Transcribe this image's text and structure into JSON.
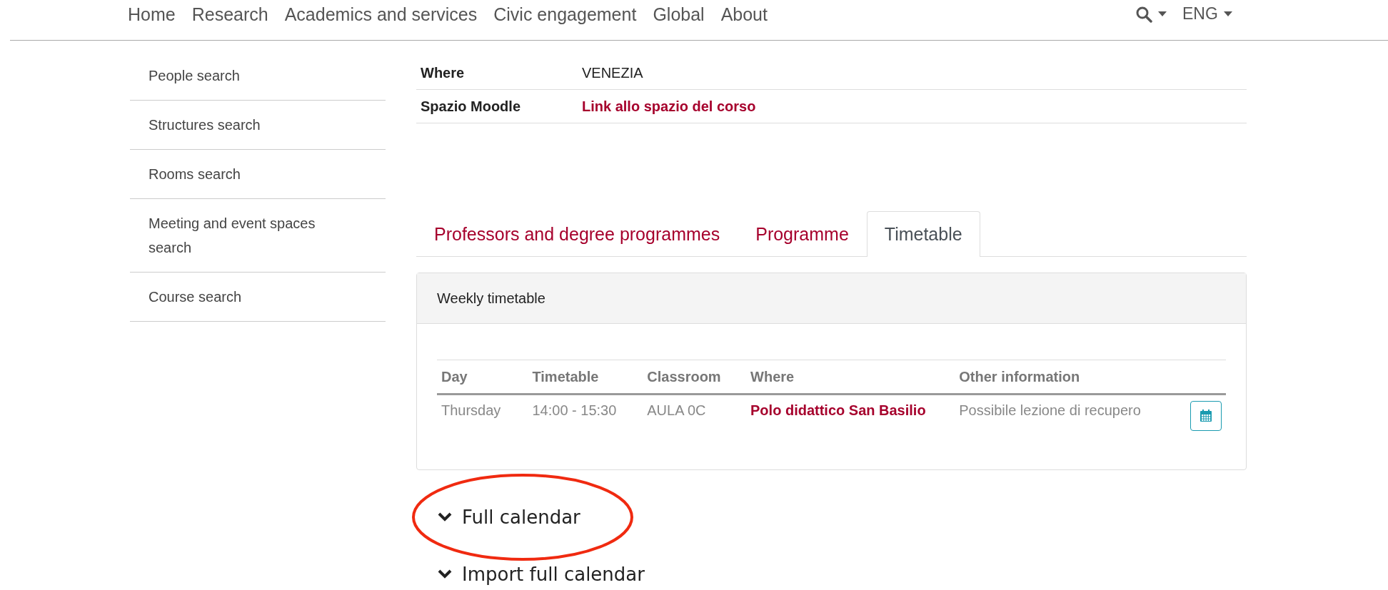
{
  "nav": {
    "items": [
      "Home",
      "Research",
      "Academics and services",
      "Civic engagement",
      "Global",
      "About"
    ],
    "language": "ENG"
  },
  "sidebar": {
    "items": [
      "People search",
      "Structures search",
      "Rooms search",
      "Meeting and event spaces search",
      "Course search"
    ]
  },
  "course_info": {
    "rows": [
      {
        "label": "Where",
        "value": "VENEZIA",
        "kind": "text"
      },
      {
        "label": "Spazio Moodle",
        "value": "Link allo spazio del corso",
        "kind": "link"
      }
    ]
  },
  "tabs": [
    {
      "label": "Professors and degree programmes",
      "selected": false
    },
    {
      "label": "Programme",
      "selected": false
    },
    {
      "label": "Timetable",
      "selected": true
    }
  ],
  "panel": {
    "title": "Weekly timetable",
    "table": {
      "columns": [
        "Day",
        "Timetable",
        "Classroom",
        "Where",
        "Other information"
      ],
      "rows": [
        {
          "cells": [
            {
              "text": "Thursday",
              "kind": "text"
            },
            {
              "text": "14:00 - 15:30",
              "kind": "text"
            },
            {
              "text": "AULA 0C",
              "kind": "text"
            },
            {
              "text": "Polo didattico San Basilio",
              "kind": "link"
            },
            {
              "text": "Possibile lezione di recupero",
              "kind": "text"
            }
          ]
        }
      ]
    }
  },
  "toggles": [
    {
      "label": "Full calendar",
      "highlighted": true
    },
    {
      "label": "Import full calendar",
      "highlighted": false
    }
  ]
}
